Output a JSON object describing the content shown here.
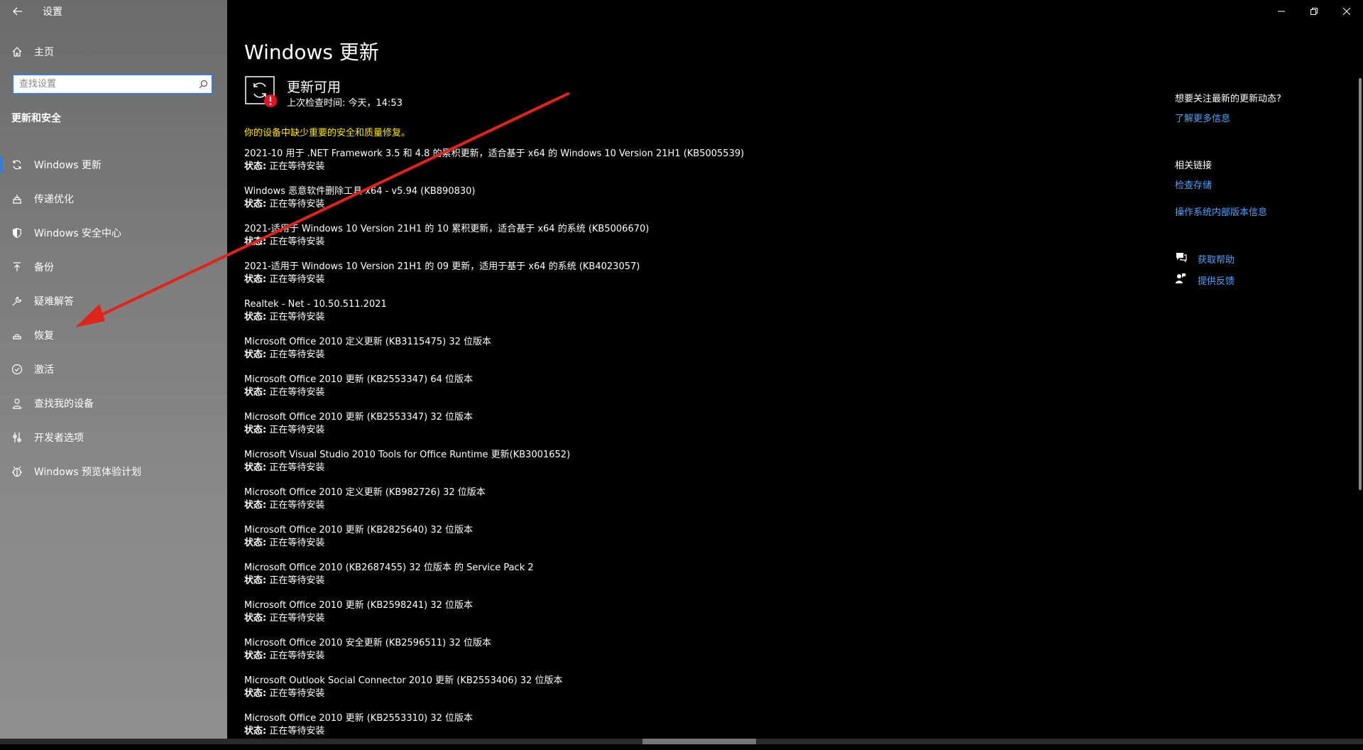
{
  "app": {
    "title": "设置"
  },
  "sidebar": {
    "home_label": "主页",
    "search_placeholder": "查找设置",
    "section_title": "更新和安全",
    "items": [
      {
        "label": "Windows 更新",
        "icon": "sync-icon",
        "active": true
      },
      {
        "label": "传递优化",
        "icon": "delivery-optimization-icon"
      },
      {
        "label": "Windows 安全中心",
        "icon": "shield-icon"
      },
      {
        "label": "备份",
        "icon": "backup-icon"
      },
      {
        "label": "疑难解答",
        "icon": "wrench-icon"
      },
      {
        "label": "恢复",
        "icon": "recovery-icon"
      },
      {
        "label": "激活",
        "icon": "check-circle-icon"
      },
      {
        "label": "查找我的设备",
        "icon": "find-device-icon"
      },
      {
        "label": "开发者选项",
        "icon": "developer-icon"
      },
      {
        "label": "Windows 预览体验计划",
        "icon": "insider-icon"
      }
    ]
  },
  "main": {
    "title": "Windows 更新",
    "status_heading": "更新可用",
    "last_checked": "上次检查时间: 今天，14:53",
    "warning": "你的设备中缺少重要的安全和质量修复。",
    "status_label": "状态:",
    "updates": [
      {
        "title": "2021-10 用于 .NET Framework 3.5 和 4.8 的累积更新，适合基于 x64 的 Windows 10 Version 21H1 (KB5005539)",
        "status": "正在等待安装"
      },
      {
        "title": "Windows 恶意软件删除工具 x64 - v5.94 (KB890830)",
        "status": "正在等待安装"
      },
      {
        "title": "2021-适用于 Windows 10 Version 21H1 的 10 累积更新，适合基于 x64 的系统 (KB5006670)",
        "status": "正在等待安装"
      },
      {
        "title": "2021-适用于 Windows 10 Version 21H1 的 09 更新，适用于基于 x64 的系统 (KB4023057)",
        "status": "正在等待安装"
      },
      {
        "title": "Realtek - Net - 10.50.511.2021",
        "status": "正在等待安装"
      },
      {
        "title": "Microsoft Office 2010 定义更新 (KB3115475) 32 位版本",
        "status": "正在等待安装"
      },
      {
        "title": "Microsoft Office 2010 更新 (KB2553347) 64 位版本",
        "status": "正在等待安装"
      },
      {
        "title": "Microsoft Office 2010 更新 (KB2553347) 32 位版本",
        "status": "正在等待安装"
      },
      {
        "title": "Microsoft Visual Studio 2010 Tools for Office Runtime 更新(KB3001652)",
        "status": "正在等待安装"
      },
      {
        "title": "Microsoft Office 2010 定义更新 (KB982726) 32 位版本",
        "status": "正在等待安装"
      },
      {
        "title": "Microsoft Office 2010 更新 (KB2825640) 32 位版本",
        "status": "正在等待安装"
      },
      {
        "title": "Microsoft Office 2010 (KB2687455) 32 位版本 的 Service Pack 2",
        "status": "正在等待安装"
      },
      {
        "title": "Microsoft Office 2010 更新 (KB2598241) 32 位版本",
        "status": "正在等待安装"
      },
      {
        "title": "Microsoft Office 2010 安全更新 (KB2596511) 32 位版本",
        "status": "正在等待安装"
      },
      {
        "title": "Microsoft Outlook Social Connector 2010 更新 (KB2553406) 32 位版本",
        "status": "正在等待安装"
      },
      {
        "title": "Microsoft Office 2010 更新 (KB2553310) 32 位版本",
        "status": "正在等待安装"
      }
    ]
  },
  "right_panel": {
    "question": "想要关注最新的更新动态?",
    "learn_more": "了解更多信息",
    "related_heading": "相关链接",
    "check_storage": "检查存储",
    "os_build_info": "操作系统内部版本信息",
    "get_help": "获取帮助",
    "give_feedback": "提供反馈"
  },
  "colors": {
    "accent": "#3a7bd5",
    "link": "#4aa3ff",
    "warning": "#ffe600",
    "annotation_arrow": "#e0241b"
  }
}
